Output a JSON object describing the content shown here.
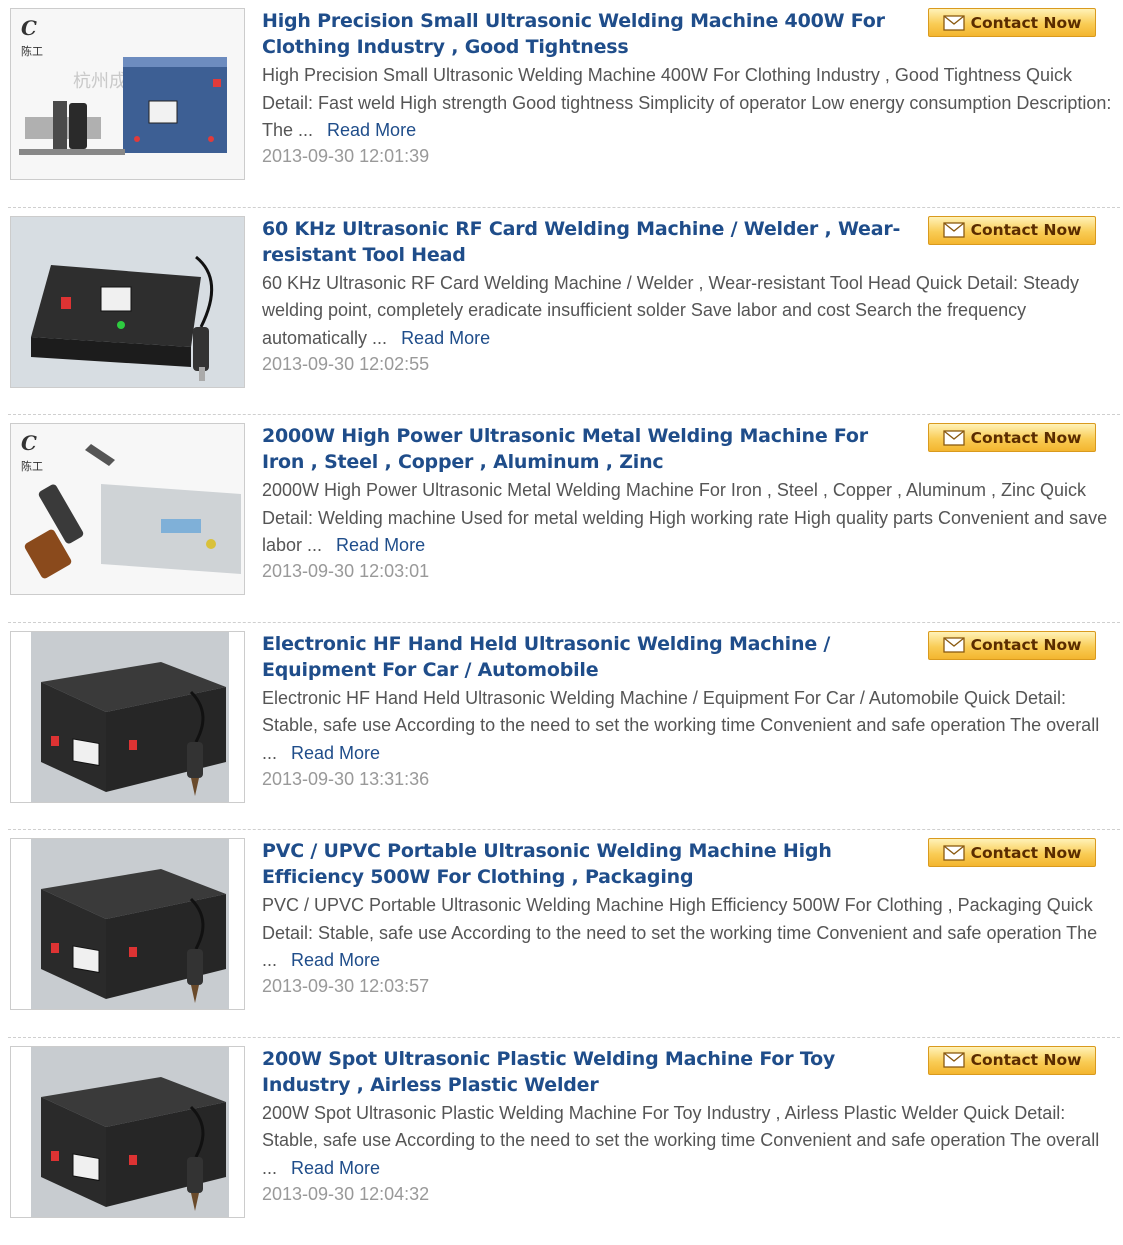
{
  "contact_label": "Contact Now",
  "read_more_label": "Read More",
  "logo_text": "陈工",
  "watermark_text": "杭州成",
  "products": [
    {
      "title": "High Precision Small Ultrasonic Welding Machine 400W For Clothing Industry , Good Tightness",
      "description": "High Precision Small Ultrasonic Welding Machine 400W For Clothing Industry , Good Tightness Quick Detail: Fast weld High strength Good tightness Simplicity of operator Low energy consumption Description: The ...",
      "date": "2013-09-30 12:01:39",
      "image": "welder-with-horn-logo"
    },
    {
      "title": "60 KHz Ultrasonic RF Card Welding Machine / Welder , Wear-resistant Tool Head",
      "description": "60 KHz Ultrasonic RF Card Welding Machine / Welder , Wear-resistant Tool Head Quick Detail: Steady welding point, completely eradicate insufficient solder Save labor and cost Search the frequency automatically ...",
      "date": "2013-09-30 12:02:55",
      "image": "welder-box-with-pen"
    },
    {
      "title": "2000W High Power Ultrasonic Metal Welding Machine For Iron , Steel , Copper , Aluminum , Zinc",
      "description": "2000W High Power Ultrasonic Metal Welding Machine For Iron , Steel , Copper , Aluminum , Zinc Quick Detail: Welding machine Used for metal welding High working rate High quality parts Convenient and save labor ...",
      "date": "2013-09-30 12:03:01",
      "image": "metal-welder-logo"
    },
    {
      "title": "Electronic HF Hand Held Ultrasonic Welding Machine / Equipment For Car / Automobile",
      "description": "Electronic HF Hand Held Ultrasonic Welding Machine / Equipment For Car / Automobile Quick Detail: Stable, safe use According to the need to set the working time Convenient and safe operation The overall ...",
      "date": "2013-09-30 13:31:36",
      "image": "handheld-welder-box"
    },
    {
      "title": "PVC / UPVC Portable Ultrasonic Welding Machine High Efficiency 500W For Clothing , Packaging",
      "description": "PVC / UPVC Portable Ultrasonic Welding Machine High Efficiency 500W For Clothing , Packaging Quick Detail: Stable, safe use According to the need to set the working time Convenient and safe operation The ...",
      "date": "2013-09-30 12:03:57",
      "image": "handheld-welder-box"
    },
    {
      "title": "200W Spot Ultrasonic Plastic Welding Machine For Toy Industry , Airless Plastic Welder",
      "description": "200W Spot Ultrasonic Plastic Welding Machine For Toy Industry , Airless Plastic Welder Quick Detail: Stable, safe use According to the need to set the working time Convenient and safe operation The overall ...",
      "date": "2013-09-30 12:04:32",
      "image": "handheld-welder-box"
    }
  ]
}
